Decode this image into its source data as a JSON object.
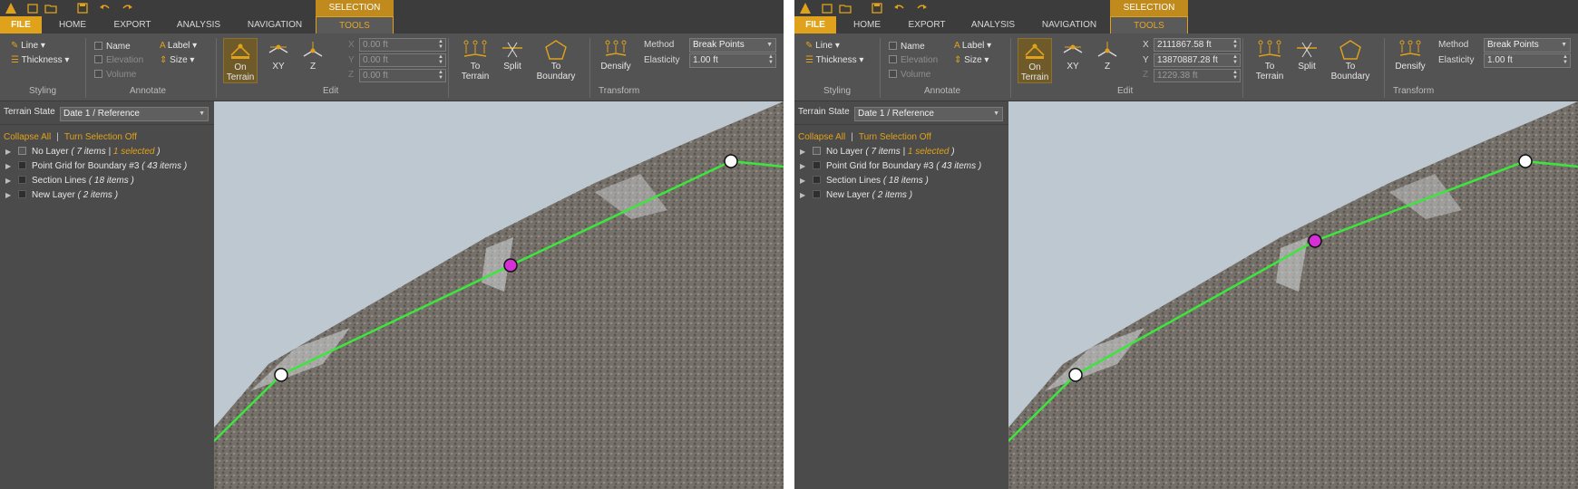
{
  "panes": [
    {
      "context_tab": "SELECTION",
      "tabs": {
        "file": "FILE",
        "home": "HOME",
        "export": "EXPORT",
        "analysis": "ANALYSIS",
        "navigation": "NAVIGATION",
        "tools": "TOOLS"
      },
      "styling": {
        "line": "Line",
        "thickness": "Thickness",
        "group": "Styling"
      },
      "annotate": {
        "name": "Name",
        "elevation": "Elevation",
        "volume": "Volume",
        "label": "Label",
        "size": "Size",
        "group": "Annotate"
      },
      "edit": {
        "on_terrain_1": "On",
        "on_terrain_2": "Terrain",
        "xy": "XY",
        "z": "Z",
        "x_label": "X",
        "y_label": "Y",
        "z_label": "Z",
        "x_value": "0.00 ft",
        "y_value": "0.00 ft",
        "z_value": "0.00 ft",
        "group": "Edit"
      },
      "transform": {
        "to_terrain_1": "To",
        "to_terrain_2": "Terrain",
        "split": "Split",
        "to_boundary_1": "To",
        "to_boundary_2": "Boundary",
        "densify": "Densify",
        "method_label": "Method",
        "method_value": "Break Points",
        "elasticity_label": "Elasticity",
        "elasticity_value": "1.00 ft",
        "group": "Transform"
      },
      "terrain_state": {
        "label": "Terrain State",
        "value": "Date 1 / Reference"
      },
      "collapse_all": "Collapse All",
      "turn_selection_off": "Turn Selection Off",
      "layers": [
        {
          "name": "No Layer",
          "count": "( 7 items |",
          "selected": "1 selected",
          "close": ")"
        },
        {
          "name": "Point Grid for Boundary #3",
          "count": "( 43 items )"
        },
        {
          "name": "Section Lines",
          "count": "( 18 items )"
        },
        {
          "name": "New Layer",
          "count": "( 2 items )"
        }
      ]
    },
    {
      "context_tab": "SELECTION",
      "tabs": {
        "file": "FILE",
        "home": "HOME",
        "export": "EXPORT",
        "analysis": "ANALYSIS",
        "navigation": "NAVIGATION",
        "tools": "TOOLS"
      },
      "styling": {
        "line": "Line",
        "thickness": "Thickness",
        "group": "Styling"
      },
      "annotate": {
        "name": "Name",
        "elevation": "Elevation",
        "volume": "Volume",
        "label": "Label",
        "size": "Size",
        "group": "Annotate"
      },
      "edit": {
        "on_terrain_1": "On",
        "on_terrain_2": "Terrain",
        "xy": "XY",
        "z": "Z",
        "x_label": "X",
        "y_label": "Y",
        "z_label": "Z",
        "x_value": "2111867.58 ft",
        "y_value": "13870887.28 ft",
        "z_value": "1229.38 ft",
        "group": "Edit"
      },
      "transform": {
        "to_terrain_1": "To",
        "to_terrain_2": "Terrain",
        "split": "Split",
        "to_boundary_1": "To",
        "to_boundary_2": "Boundary",
        "densify": "Densify",
        "method_label": "Method",
        "method_value": "Break Points",
        "elasticity_label": "Elasticity",
        "elasticity_value": "1.00 ft",
        "group": "Transform"
      },
      "terrain_state": {
        "label": "Terrain State",
        "value": "Date 1 / Reference"
      },
      "collapse_all": "Collapse All",
      "turn_selection_off": "Turn Selection Off",
      "layers": [
        {
          "name": "No Layer",
          "count": "( 7 items |",
          "selected": "1 selected",
          "close": ")"
        },
        {
          "name": "Point Grid for Boundary #3",
          "count": "( 43 items )"
        },
        {
          "name": "Section Lines",
          "count": "( 18 items )"
        },
        {
          "name": "New Layer",
          "count": "( 2 items )"
        }
      ]
    }
  ],
  "colors": {
    "accent": "#e0a21a",
    "line": "#3ce63c",
    "selected_vertex": "#d62fd6",
    "panel": "#4b4b4b",
    "ribbon": "#535353"
  }
}
